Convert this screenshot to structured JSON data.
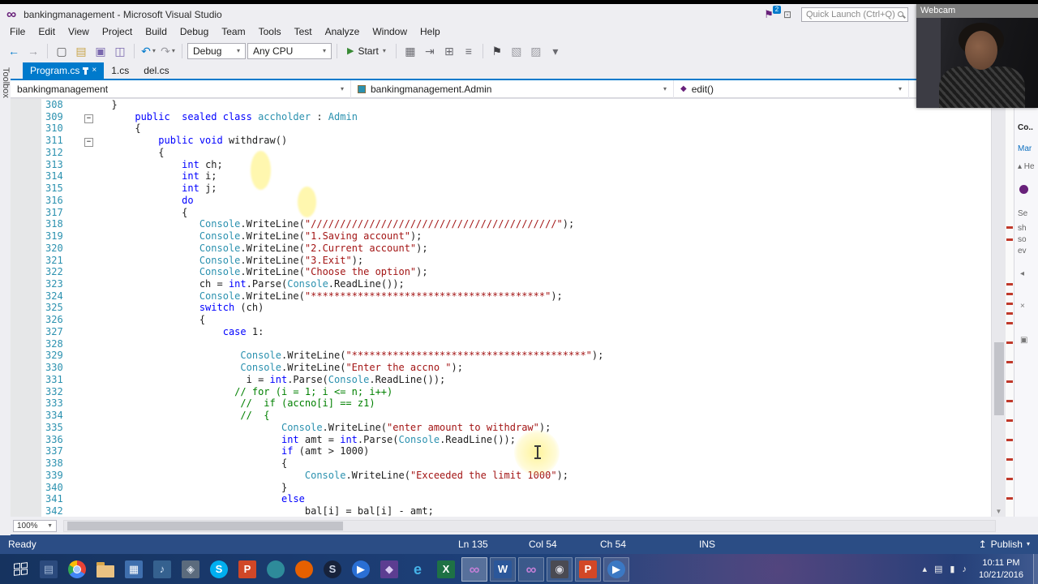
{
  "colors": {
    "accent": "#007acc",
    "keyword": "#0000ff",
    "type": "#2b91af",
    "string": "#a31515",
    "comment": "#008000",
    "status_bg": "#2b4d85",
    "vs_purple": "#68217a"
  },
  "titlebar": {
    "title": "bankingmanagement - Microsoft Visual Studio",
    "quick_launch_placeholder": "Quick Launch (Ctrl+Q)",
    "notification_badge": "2"
  },
  "webcam": {
    "label": "Webcam"
  },
  "menus": [
    "File",
    "Edit",
    "View",
    "Project",
    "Build",
    "Debug",
    "Team",
    "Tools",
    "Test",
    "Analyze",
    "Window",
    "Help"
  ],
  "toolbar": {
    "items": [
      {
        "type": "icon",
        "name": "navigate-back",
        "glyph": "←",
        "color": "#007acc"
      },
      {
        "type": "icon",
        "name": "navigate-forward",
        "glyph": "→",
        "color": "#9a9aa0"
      },
      {
        "type": "sep"
      },
      {
        "type": "icon",
        "name": "new-file",
        "glyph": "▢",
        "color": "#5a5a5a"
      },
      {
        "type": "icon",
        "name": "open-file",
        "glyph": "▤",
        "color": "#c8a64b"
      },
      {
        "type": "icon",
        "name": "save",
        "glyph": "▣",
        "color": "#7a68ae"
      },
      {
        "type": "icon",
        "name": "save-all",
        "glyph": "◫",
        "color": "#7a68ae"
      },
      {
        "type": "sep"
      },
      {
        "type": "icon",
        "name": "undo",
        "glyph": "↶",
        "color": "#007acc",
        "caret": true
      },
      {
        "type": "icon",
        "name": "redo",
        "glyph": "↷",
        "color": "#9a9aa0",
        "caret": true
      },
      {
        "type": "sep"
      },
      {
        "type": "select",
        "name": "solution-configurations",
        "label": "Debug",
        "cls": "cfg"
      },
      {
        "type": "select",
        "name": "solution-platforms",
        "label": "Any CPU",
        "cls": "plat"
      },
      {
        "type": "sep"
      },
      {
        "type": "start",
        "name": "start-debugging",
        "label": "Start"
      },
      {
        "type": "sep"
      },
      {
        "type": "icon",
        "name": "attach-process",
        "glyph": "▦",
        "color": "#6a6a70"
      },
      {
        "type": "icon",
        "name": "step-into",
        "glyph": "⇥",
        "color": "#6a6a70"
      },
      {
        "type": "icon",
        "name": "breakpoints-window",
        "glyph": "⊞",
        "color": "#6a6a70"
      },
      {
        "type": "icon",
        "name": "outline-mode",
        "glyph": "≡",
        "color": "#6a6a70"
      },
      {
        "type": "sep"
      },
      {
        "type": "icon",
        "name": "bookmark",
        "glyph": "⚑",
        "color": "#3e3e42"
      },
      {
        "type": "icon",
        "name": "comment-out",
        "glyph": "▧",
        "color": "#9a9aa0"
      },
      {
        "type": "icon",
        "name": "uncomment",
        "glyph": "▨",
        "color": "#9a9aa0"
      },
      {
        "type": "icon",
        "name": "more-options",
        "glyph": "▾",
        "color": "#6a6a70"
      }
    ]
  },
  "tabs": [
    {
      "label": "Program.cs",
      "active": true
    },
    {
      "label": "1.cs",
      "active": false
    },
    {
      "label": "del.cs",
      "active": false
    }
  ],
  "navbar": {
    "project": "bankingmanagement",
    "type_name": "bankingmanagement.Admin",
    "member": "edit()"
  },
  "toolbox": {
    "label": "Toolbox"
  },
  "editor": {
    "zoom_level": "100%",
    "scroll_marks": [
      157,
      172,
      227,
      239,
      251,
      263,
      275,
      299,
      323,
      347,
      371,
      395,
      419,
      443,
      467,
      491
    ],
    "lines": [
      {
        "n": 308,
        "segs": [
          [
            "p",
            "  }"
          ]
        ]
      },
      {
        "n": 309,
        "fold": true,
        "segs": [
          [
            "p",
            "      "
          ],
          [
            "k",
            "public  sealed class "
          ],
          [
            "t",
            "accholder"
          ],
          [
            "p",
            " : "
          ],
          [
            "t",
            "Admin"
          ]
        ]
      },
      {
        "n": 310,
        "segs": [
          [
            "p",
            "      {"
          ]
        ]
      },
      {
        "n": 311,
        "fold": true,
        "segs": [
          [
            "p",
            "          "
          ],
          [
            "k",
            "public void "
          ],
          [
            "p",
            "withdraw()"
          ]
        ]
      },
      {
        "n": 312,
        "segs": [
          [
            "p",
            "          {"
          ]
        ]
      },
      {
        "n": 313,
        "segs": [
          [
            "p",
            "              "
          ],
          [
            "k",
            "int"
          ],
          [
            "p",
            " ch;"
          ]
        ]
      },
      {
        "n": 314,
        "segs": [
          [
            "p",
            "              "
          ],
          [
            "k",
            "int"
          ],
          [
            "p",
            " i;"
          ]
        ]
      },
      {
        "n": 315,
        "segs": [
          [
            "p",
            "              "
          ],
          [
            "k",
            "int"
          ],
          [
            "p",
            " j;"
          ]
        ]
      },
      {
        "n": 316,
        "segs": [
          [
            "p",
            "              "
          ],
          [
            "k",
            "do"
          ]
        ]
      },
      {
        "n": 317,
        "segs": [
          [
            "p",
            "              {"
          ]
        ]
      },
      {
        "n": 318,
        "segs": [
          [
            "p",
            "                 "
          ],
          [
            "t",
            "Console"
          ],
          [
            "p",
            ".WriteLine("
          ],
          [
            "s",
            "\"//////////////////////////////////////////\""
          ],
          [
            "p",
            ");"
          ]
        ]
      },
      {
        "n": 319,
        "segs": [
          [
            "p",
            "                 "
          ],
          [
            "t",
            "Console"
          ],
          [
            "p",
            ".WriteLine("
          ],
          [
            "s",
            "\"1.Saving account\""
          ],
          [
            "p",
            ");"
          ]
        ]
      },
      {
        "n": 320,
        "segs": [
          [
            "p",
            "                 "
          ],
          [
            "t",
            "Console"
          ],
          [
            "p",
            ".WriteLine("
          ],
          [
            "s",
            "\"2.Current account\""
          ],
          [
            "p",
            ");"
          ]
        ]
      },
      {
        "n": 321,
        "segs": [
          [
            "p",
            "                 "
          ],
          [
            "t",
            "Console"
          ],
          [
            "p",
            ".WriteLine("
          ],
          [
            "s",
            "\"3.Exit\""
          ],
          [
            "p",
            ");"
          ]
        ]
      },
      {
        "n": 322,
        "segs": [
          [
            "p",
            "                 "
          ],
          [
            "t",
            "Console"
          ],
          [
            "p",
            ".WriteLine("
          ],
          [
            "s",
            "\"Choose the option\""
          ],
          [
            "p",
            ");"
          ]
        ]
      },
      {
        "n": 323,
        "segs": [
          [
            "p",
            "                 ch = "
          ],
          [
            "k",
            "int"
          ],
          [
            "p",
            ".Parse("
          ],
          [
            "t",
            "Console"
          ],
          [
            "p",
            ".ReadLine());"
          ]
        ]
      },
      {
        "n": 324,
        "segs": [
          [
            "p",
            "                 "
          ],
          [
            "t",
            "Console"
          ],
          [
            "p",
            ".WriteLine("
          ],
          [
            "s",
            "\"****************************************\""
          ],
          [
            "p",
            ");"
          ]
        ]
      },
      {
        "n": 325,
        "segs": [
          [
            "p",
            "                 "
          ],
          [
            "k",
            "switch"
          ],
          [
            "p",
            " (ch)"
          ]
        ]
      },
      {
        "n": 326,
        "segs": [
          [
            "p",
            "                 {"
          ]
        ]
      },
      {
        "n": 327,
        "segs": [
          [
            "p",
            "                     "
          ],
          [
            "k",
            "case"
          ],
          [
            "p",
            " 1:"
          ]
        ]
      },
      {
        "n": 328,
        "segs": []
      },
      {
        "n": 329,
        "segs": [
          [
            "p",
            "                        "
          ],
          [
            "t",
            "Console"
          ],
          [
            "p",
            ".WriteLine("
          ],
          [
            "s",
            "\"****************************************\""
          ],
          [
            "p",
            ");"
          ]
        ]
      },
      {
        "n": 330,
        "segs": [
          [
            "p",
            "                        "
          ],
          [
            "t",
            "Console"
          ],
          [
            "p",
            ".WriteLine("
          ],
          [
            "s",
            "\"Enter the accno \""
          ],
          [
            "p",
            ");"
          ]
        ]
      },
      {
        "n": 331,
        "segs": [
          [
            "p",
            "                         i = "
          ],
          [
            "k",
            "int"
          ],
          [
            "p",
            ".Parse("
          ],
          [
            "t",
            "Console"
          ],
          [
            "p",
            ".ReadLine());"
          ]
        ]
      },
      {
        "n": 332,
        "segs": [
          [
            "p",
            "                       "
          ],
          [
            "c",
            "// for (i = 1; i <= n; i++)"
          ]
        ]
      },
      {
        "n": 333,
        "segs": [
          [
            "p",
            "                        "
          ],
          [
            "c",
            "//  if (accno[i] == z1)"
          ]
        ]
      },
      {
        "n": 334,
        "segs": [
          [
            "p",
            "                        "
          ],
          [
            "c",
            "//  {"
          ]
        ]
      },
      {
        "n": 335,
        "segs": [
          [
            "p",
            "                               "
          ],
          [
            "t",
            "Console"
          ],
          [
            "p",
            ".WriteLine("
          ],
          [
            "s",
            "\"enter amount to withdraw\""
          ],
          [
            "p",
            ");"
          ]
        ]
      },
      {
        "n": 336,
        "segs": [
          [
            "p",
            "                               "
          ],
          [
            "k",
            "int"
          ],
          [
            "p",
            " amt = "
          ],
          [
            "k",
            "int"
          ],
          [
            "p",
            ".Parse("
          ],
          [
            "t",
            "Console"
          ],
          [
            "p",
            ".ReadLine());"
          ]
        ]
      },
      {
        "n": 337,
        "segs": [
          [
            "p",
            "                               "
          ],
          [
            "k",
            "if"
          ],
          [
            "p",
            " (amt > 1000)"
          ]
        ]
      },
      {
        "n": 338,
        "segs": [
          [
            "p",
            "                               {"
          ]
        ]
      },
      {
        "n": 339,
        "segs": [
          [
            "p",
            "                                   "
          ],
          [
            "t",
            "Console"
          ],
          [
            "p",
            ".WriteLine("
          ],
          [
            "s",
            "\"Exceeded the limit 1000\""
          ],
          [
            "p",
            ");"
          ]
        ]
      },
      {
        "n": 340,
        "segs": [
          [
            "p",
            "                               }"
          ]
        ]
      },
      {
        "n": 341,
        "segs": [
          [
            "p",
            "                               "
          ],
          [
            "k",
            "else"
          ]
        ]
      },
      {
        "n": 342,
        "segs": [
          [
            "p",
            "                                   bal[i] = bal[i] - amt;"
          ]
        ]
      }
    ]
  },
  "right_panel": {
    "fragments": [
      "Co..",
      "Mar",
      "▴ He",
      "Se",
      "sh",
      "so",
      "ev"
    ]
  },
  "statusbar": {
    "ready": "Ready",
    "line": "Ln 135",
    "column": "Col 54",
    "character": "Ch 54",
    "mode": "INS",
    "publish": "Publish"
  },
  "taskbar": {
    "clock": {
      "time": "10:11 PM",
      "date": "10/21/2016"
    },
    "tray_icons": [
      {
        "name": "show-hidden-icons",
        "glyph": "▴"
      },
      {
        "name": "network-icon",
        "glyph": "▤"
      },
      {
        "name": "battery-icon",
        "glyph": "▮"
      },
      {
        "name": "volume-icon",
        "glyph": "♪"
      }
    ],
    "icons": [
      {
        "name": "app-tile-blue",
        "kind": "tile",
        "bg": "#2b4a7d",
        "glyph": "▤",
        "fg": "#9fb6d4"
      },
      {
        "name": "chrome",
        "kind": "chrome"
      },
      {
        "name": "file-explorer",
        "kind": "folder"
      },
      {
        "name": "calculator",
        "kind": "tile",
        "bg": "#3f6fae",
        "glyph": "▦",
        "fg": "#ffffff"
      },
      {
        "name": "media-app",
        "kind": "tile",
        "bg": "#35618f",
        "glyph": "♪",
        "fg": "#cfe0f2"
      },
      {
        "name": "settings-app",
        "kind": "tile",
        "bg": "#5b6b7d",
        "glyph": "◈",
        "fg": "#dde4ec"
      },
      {
        "name": "skype",
        "kind": "circle",
        "bg": "#00aff0",
        "glyph": "S",
        "fg": "#ffffff"
      },
      {
        "name": "presentation-app",
        "kind": "tile",
        "bg": "#d04727",
        "glyph": "P",
        "fg": "#ffffff"
      },
      {
        "name": "app-teal",
        "kind": "circle",
        "bg": "#2e8b9a",
        "glyph": "",
        "fg": "#ffffff"
      },
      {
        "name": "firefox",
        "kind": "circle",
        "bg": "#e66000",
        "glyph": "",
        "fg": "#ffffff"
      },
      {
        "name": "steam",
        "kind": "circle",
        "bg": "#17223b",
        "glyph": "S",
        "fg": "#cfd8ea"
      },
      {
        "name": "media-player",
        "kind": "circle",
        "bg": "#2a6fd4",
        "glyph": "▶",
        "fg": "#ffffff"
      },
      {
        "name": "app-purple",
        "kind": "tile",
        "bg": "#5c3d91",
        "glyph": "◆",
        "fg": "#d9c9f2"
      },
      {
        "name": "internet-explorer",
        "kind": "glyph",
        "glyph": "e",
        "fg": "#45b2e8"
      },
      {
        "name": "excel",
        "kind": "tile",
        "bg": "#1e7145",
        "glyph": "X",
        "fg": "#ffffff"
      },
      {
        "name": "visual-studio",
        "kind": "glyph",
        "glyph": "∞",
        "fg": "#c27fd6",
        "open": true,
        "active": true
      },
      {
        "name": "word",
        "kind": "tile",
        "bg": "#2b579a",
        "glyph": "W",
        "fg": "#ffffff",
        "open": true
      },
      {
        "name": "visual-studio-2",
        "kind": "glyph",
        "glyph": "∞",
        "fg": "#c27fd6",
        "open": true
      },
      {
        "name": "camera-app",
        "kind": "tile",
        "bg": "#4a4a52",
        "glyph": "◉",
        "fg": "#d8d8e0",
        "open": true
      },
      {
        "name": "powerpoint",
        "kind": "tile",
        "bg": "#d24726",
        "glyph": "P",
        "fg": "#ffffff",
        "open": true
      },
      {
        "name": "video-app",
        "kind": "circle",
        "bg": "#3b78c3",
        "glyph": "▶",
        "fg": "#ffffff",
        "open": true
      }
    ]
  }
}
